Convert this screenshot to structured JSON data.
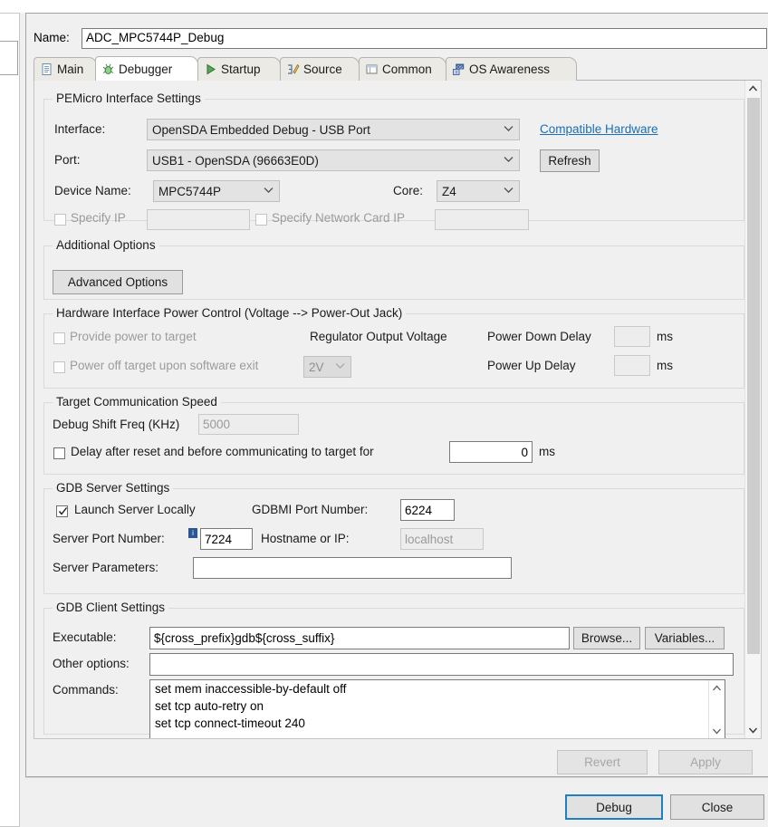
{
  "dialog": {
    "name_label": "Name:",
    "name_value": "ADC_MPC5744P_Debug",
    "tabs": [
      {
        "label": "Main",
        "icon": "document-icon",
        "selected": false
      },
      {
        "label": "Debugger",
        "icon": "bug-icon",
        "selected": true
      },
      {
        "label": "Startup",
        "icon": "run-icon",
        "selected": false
      },
      {
        "label": "Source",
        "icon": "source-icon",
        "selected": false
      },
      {
        "label": "Common",
        "icon": "common-icon",
        "selected": false
      },
      {
        "label": "OS Awareness",
        "icon": "os-icon",
        "selected": false
      }
    ]
  },
  "pemicro": {
    "group_title": "PEMicro Interface Settings",
    "interface_label": "Interface:",
    "interface_value": "OpenSDA Embedded Debug - USB Port",
    "compatible_hardware_link": "Compatible Hardware",
    "port_label": "Port:",
    "port_value": "USB1 - OpenSDA (96663E0D)",
    "refresh_button": "Refresh",
    "device_name_label": "Device Name:",
    "device_name_value": "MPC5744P",
    "core_label": "Core:",
    "core_value": "Z4",
    "specify_ip_label": "Specify IP",
    "specify_ip_checked": false,
    "specify_ip_value": "",
    "specify_network_card_ip_label": "Specify Network Card IP",
    "specify_network_card_ip_checked": false,
    "specify_network_card_ip_value": ""
  },
  "additional_options": {
    "group_title": "Additional Options",
    "advanced_options_button": "Advanced Options"
  },
  "power_control": {
    "group_title": "Hardware Interface Power Control (Voltage --> Power-Out Jack)",
    "provide_power_label": "Provide power to target",
    "provide_power_checked": false,
    "power_off_exit_label": "Power off target upon software exit",
    "power_off_exit_checked": false,
    "regulator_label": "Regulator Output Voltage",
    "regulator_value": "2V",
    "power_down_delay_label": "Power Down Delay",
    "power_down_delay_value": "",
    "power_down_delay_unit": "ms",
    "power_up_delay_label": "Power Up Delay",
    "power_up_delay_value": "",
    "power_up_delay_unit": "ms"
  },
  "target_speed": {
    "group_title": "Target Communication Speed",
    "debug_shift_freq_label": "Debug Shift Freq (KHz)",
    "debug_shift_freq_value": "5000",
    "delay_checkbox_label": "Delay after reset and before communicating to target for",
    "delay_checked": false,
    "delay_value": "0",
    "delay_unit": "ms"
  },
  "gdb_server": {
    "group_title": "GDB Server Settings",
    "launch_locally_label": "Launch Server Locally",
    "launch_locally_checked": true,
    "gdbmi_port_label": "GDBMI Port Number:",
    "gdbmi_port_value": "6224",
    "server_port_label": "Server Port Number:",
    "server_port_value": "7224",
    "server_port_info_icon": "info-icon",
    "hostname_label": "Hostname or IP:",
    "hostname_value": "localhost",
    "server_params_label": "Server Parameters:",
    "server_params_value": ""
  },
  "gdb_client": {
    "group_title": "GDB Client Settings",
    "executable_label": "Executable:",
    "executable_value": "${cross_prefix}gdb${cross_suffix}",
    "browse_button": "Browse...",
    "variables_button": "Variables...",
    "other_options_label": "Other options:",
    "other_options_value": "",
    "commands_label": "Commands:",
    "commands_lines": [
      "set mem inaccessible-by-default off",
      "set tcp auto-retry on",
      "set tcp connect-timeout 240"
    ]
  },
  "footer": {
    "revert_button": "Revert",
    "apply_button": "Apply",
    "debug_button": "Debug",
    "close_button": "Close"
  },
  "colors": {
    "accent": "#1f7fbf",
    "link": "#1a6fb5",
    "info_badge": "#2b5797",
    "window_bg": "#f0f0f0"
  }
}
